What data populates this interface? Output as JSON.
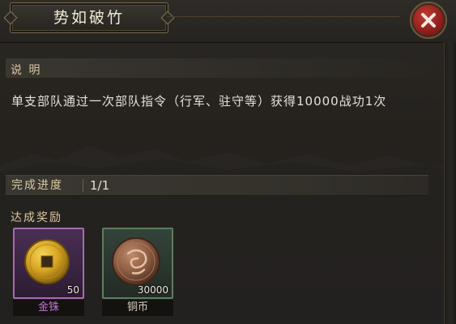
{
  "dialog": {
    "title": "势如破竹",
    "close_icon": "close-icon"
  },
  "description": {
    "label": "说 明",
    "text": "单支部队通过一次部队指令（行军、驻守等）获得10000战功1次"
  },
  "progress": {
    "label": "完成进度",
    "value": "1/1"
  },
  "rewards": {
    "label": "达成奖励",
    "items": [
      {
        "name": "金铢",
        "quantity": "50",
        "icon": "gold-coin-icon",
        "rarity_color": "#c672d8"
      },
      {
        "name": "铜币",
        "quantity": "30000",
        "icon": "copper-coin-icon",
        "rarity_color": "#5f7d5e"
      }
    ]
  },
  "colors": {
    "label_gold": "#d8c9a2",
    "close_red": "#c53a33"
  }
}
